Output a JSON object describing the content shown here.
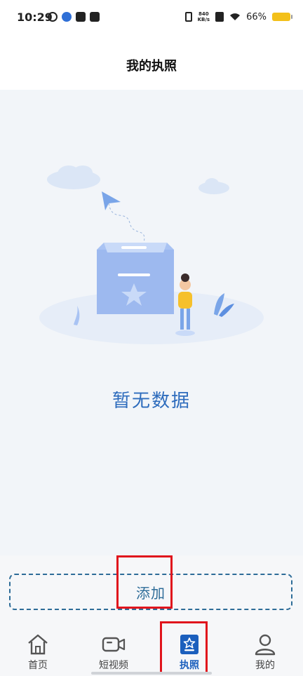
{
  "status_bar": {
    "time": "10:29",
    "net_speed_value": "840",
    "net_speed_unit": "KB/s",
    "battery": "66%"
  },
  "header": {
    "title": "我的执照"
  },
  "empty_state": {
    "message": "暂无数据"
  },
  "actions": {
    "add_label": "添加"
  },
  "tabs": [
    {
      "label": "首页",
      "icon": "home-icon"
    },
    {
      "label": "短视频",
      "icon": "video-icon"
    },
    {
      "label": "执照",
      "icon": "license-star-icon",
      "active": true
    },
    {
      "label": "我的",
      "icon": "profile-icon"
    }
  ],
  "colors": {
    "accent": "#2e6cbd",
    "add_border": "#2d6c98",
    "highlight": "#e0141c",
    "battery": "#f3c01a"
  }
}
